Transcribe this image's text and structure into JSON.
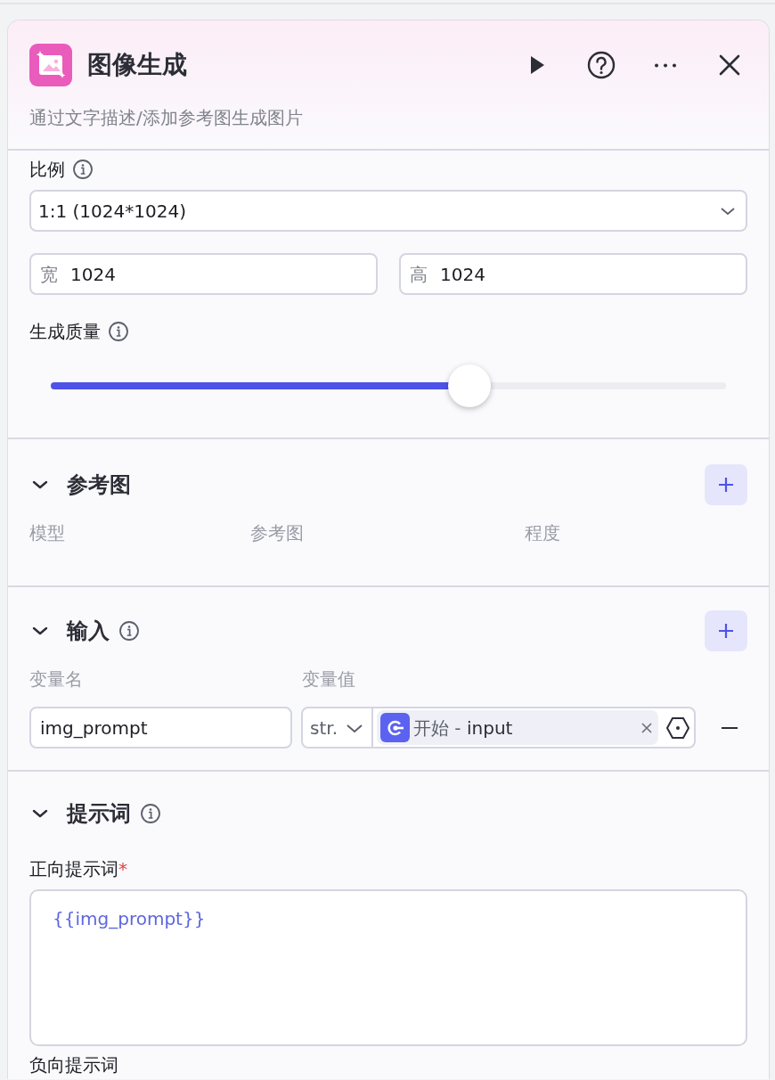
{
  "node": {
    "title": "图像生成",
    "description": "通过文字描述/添加参考图生成图片"
  },
  "ratio": {
    "label": "比例",
    "value": "1:1 (1024*1024)"
  },
  "size": [
    {
      "prefix": "宽",
      "value": "1024"
    },
    {
      "prefix": "高",
      "value": "1024"
    }
  ],
  "quality": {
    "label": "生成质量",
    "level": 0.62
  },
  "reference": {
    "title": "参考图",
    "expanded": true,
    "columns": [
      "模型",
      "参考图",
      "程度"
    ]
  },
  "input": {
    "title": "输入",
    "expanded": true,
    "columns": [
      "变量名",
      "变量值"
    ],
    "rows": [
      {
        "name": "img_prompt",
        "type": "str.",
        "ref_node": "开始",
        "ref_separator": "-",
        "ref_var": "input"
      }
    ]
  },
  "prompt": {
    "title": "提示词",
    "expanded": true,
    "positive": {
      "label": "正向提示词",
      "required_mark": "*",
      "value": "{{img_prompt}}"
    },
    "negative": {
      "label": "负向提示词"
    }
  }
}
